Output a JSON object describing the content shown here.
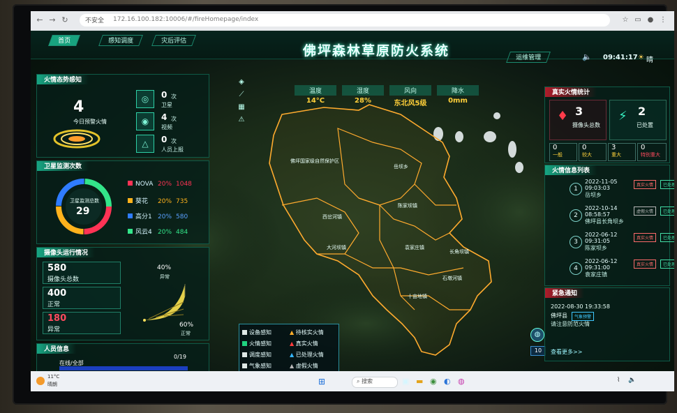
{
  "browser": {
    "security": "不安全",
    "url": "172.16.100.182:10006/#/fireHomepage/index"
  },
  "header": {
    "title": "佛坪森林草原防火系统",
    "tabs": [
      {
        "label": "首页"
      },
      {
        "label": "感知调度"
      },
      {
        "label": "灾后评估"
      }
    ],
    "right_tab": "运维管理",
    "time": "09:41:17",
    "weather": "晴"
  },
  "fire_perception": {
    "title": "火情态势感知",
    "total": "4",
    "total_label": "今日预警火情",
    "sources": [
      {
        "icon": "satellite-icon",
        "count": "0",
        "unit": "次",
        "label": "卫星"
      },
      {
        "icon": "camera-icon",
        "count": "4",
        "unit": "次",
        "label": "视频"
      },
      {
        "icon": "report-icon",
        "count": "0",
        "unit": "次",
        "label": "人员上报"
      }
    ]
  },
  "satellite": {
    "title": "卫星监测次数",
    "center_label": "卫星监测总数",
    "total": "29",
    "rows": [
      {
        "name": "NOVA",
        "pct": "20%",
        "count": "1048",
        "color": "#ff3355"
      },
      {
        "name": "葵花",
        "pct": "20%",
        "count": "735",
        "color": "#ffb21c"
      },
      {
        "name": "高分1",
        "pct": "20%",
        "count": "580",
        "color": "#2f7cff"
      },
      {
        "name": "风云4",
        "pct": "20%",
        "count": "484",
        "color": "#33e58a"
      }
    ]
  },
  "cameras": {
    "title": "摄像头运行情况",
    "total": {
      "value": "580",
      "label": "摄像头总数"
    },
    "normal": {
      "value": "400",
      "label": "正常"
    },
    "abnormal": {
      "value": "180",
      "label": "异常"
    },
    "chart_abnormal_pct": "40%",
    "chart_abnormal_label": "异常",
    "chart_normal_pct": "60%",
    "chart_normal_label": "正常"
  },
  "personnel": {
    "title": "人员信息",
    "label": "在线/全部",
    "value": "0/19"
  },
  "metrics": [
    {
      "label": "温度",
      "value": "14°C"
    },
    {
      "label": "湿度",
      "value": "28%"
    },
    {
      "label": "风向",
      "value": "东北风5级"
    },
    {
      "label": "降水",
      "value": "0mm"
    }
  ],
  "map": {
    "regions": [
      "佛坪国家级自然保护区",
      "岳坝乡",
      "陈家坝镇",
      "西岔河镇",
      "大河坝镇",
      "袁家庄镇",
      "长角坝镇",
      "石墩河镇",
      "十亩地镇"
    ],
    "zoom": "10",
    "legend": [
      {
        "label": "设备感知",
        "icon": "device-icon"
      },
      {
        "label": "待核实火情",
        "icon": "flame-icon",
        "color": "#ffae2a"
      },
      {
        "label": "火情感知",
        "icon": "fire-icon"
      },
      {
        "label": "真实火情",
        "icon": "flame-icon",
        "color": "#ff3b3b"
      },
      {
        "label": "调度感知",
        "icon": "dispatch-icon"
      },
      {
        "label": "已处理火情",
        "icon": "flame-icon",
        "color": "#35b6ff"
      },
      {
        "label": "气象感知",
        "icon": "weather-icon"
      },
      {
        "label": "虚假火情",
        "icon": "flame-icon",
        "color": "#b8b8b8"
      }
    ]
  },
  "real_fire": {
    "title": "真实火情统计",
    "cam_total": {
      "value": "3",
      "label": "摄像头总数"
    },
    "handled": {
      "value": "2",
      "label": "已处置"
    },
    "levels": [
      {
        "value": "0",
        "label": "一般"
      },
      {
        "value": "0",
        "label": "较大"
      },
      {
        "value": "3",
        "label": "重大"
      },
      {
        "value": "0",
        "label": "特别重大"
      }
    ]
  },
  "fire_list": {
    "title": "火情信息列表",
    "items": [
      {
        "n": "1",
        "date": "2022-11-05",
        "time": "09:03:03",
        "place": "岳坝乡",
        "tag1": "真实火情",
        "tag2": "已处理"
      },
      {
        "n": "2",
        "date": "2022-10-14",
        "time": "08:58:57",
        "place": "佛坪县长角坝乡",
        "tag1": "虚假火情",
        "tag2": "已处理"
      },
      {
        "n": "3",
        "date": "2022-06-12",
        "time": "09:31:05",
        "place": "陈家坝乡",
        "tag1": "真实火情",
        "tag2": "已处理"
      },
      {
        "n": "4",
        "date": "2022-06-12",
        "time": "09:31:00",
        "place": "袁家庄镇",
        "tag1": "真实火情",
        "tag2": "已处理"
      }
    ]
  },
  "urgent": {
    "title": "紧急通知",
    "datetime": "2022-08-30 19:33:58",
    "place": "佛坪县",
    "tag": "气象预警",
    "text": "请注意防范火情",
    "more": "查看更多>>"
  },
  "taskbar": {
    "temp": "11°C",
    "weather": "晴朗",
    "search": "搜索"
  }
}
